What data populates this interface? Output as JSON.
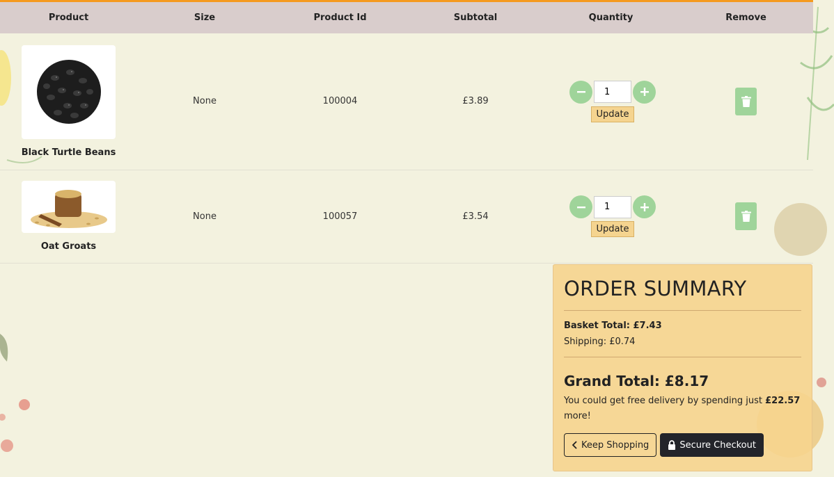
{
  "table": {
    "headers": [
      "Product",
      "Size",
      "Product Id",
      "Subtotal",
      "Quantity",
      "Remove"
    ]
  },
  "items": [
    {
      "name": "Black Turtle Beans",
      "size": "None",
      "product_id": "100004",
      "subtotal": "£3.89",
      "quantity": "1",
      "update_label": "Update",
      "image_icon": "black-beans-image"
    },
    {
      "name": "Oat Groats",
      "size": "None",
      "product_id": "100057",
      "subtotal": "£3.54",
      "quantity": "1",
      "update_label": "Update",
      "image_icon": "oat-groats-image"
    }
  ],
  "summary": {
    "title": "ORDER SUMMARY",
    "basket_total_label": "Basket Total: £7.43",
    "shipping_label": "Shipping: £0.74",
    "grand_total_label": "Grand Total: £8.17",
    "free_delivery_prefix": "You could get free delivery by spending just ",
    "free_delivery_amount": "£22.57",
    "free_delivery_suffix": " more!",
    "keep_shopping_label": "Keep Shopping",
    "checkout_label": "Secure Checkout"
  },
  "colors": {
    "accent_orange": "#f59a1f",
    "header_bg": "#d9cdcc",
    "qty_green": "#9fd49a",
    "summary_bg": "#f6d48e",
    "checkout_dark": "#23242a"
  }
}
